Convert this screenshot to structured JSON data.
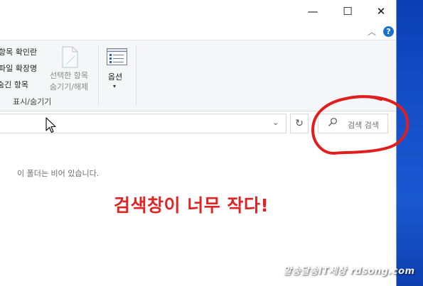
{
  "window": {
    "controls": {
      "minimize": "—",
      "maximize": "☐",
      "close": "✕"
    },
    "help_icon": "?"
  },
  "ribbon": {
    "view_options": [
      "항목 확인란",
      "파일 확장명",
      "숨긴 항목"
    ],
    "group_label": "표시/숨기기",
    "hide_selected_label": [
      "선택한 항목",
      "숨기기/해제"
    ],
    "options_label": "옵션",
    "options_arrow": "▾"
  },
  "address_bar": {
    "dropdown": "⌄",
    "refresh": "↻"
  },
  "search": {
    "placeholder": "검색 검색"
  },
  "content": {
    "empty_message": "이 폴더는 비어 있습니다."
  },
  "annotation": {
    "text": "검색창이 너무 작다!",
    "color": "#e02323"
  },
  "watermark": "알송달송IT세상 rdsong.com",
  "icons": [
    "help-icon",
    "page-icon",
    "options-icon",
    "search-icon",
    "refresh-icon",
    "mouse-cursor-icon"
  ]
}
